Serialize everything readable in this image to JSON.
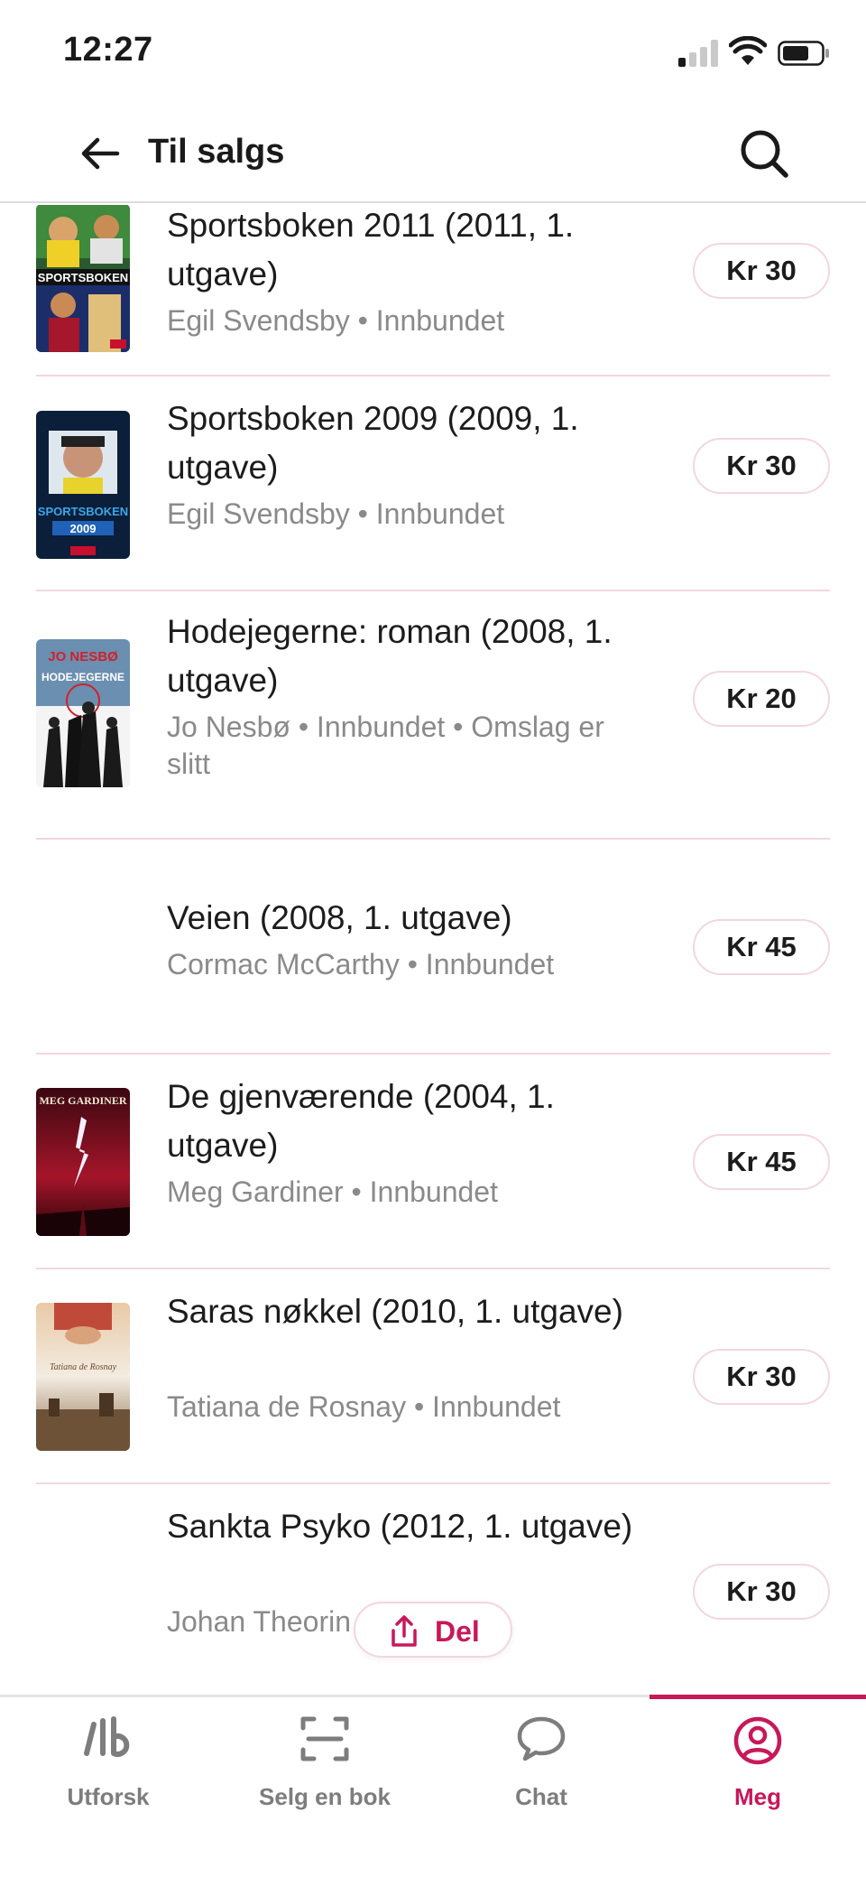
{
  "status_bar": {
    "time": "12:27"
  },
  "header": {
    "title": "Til salgs",
    "back_icon": "arrow-left-icon",
    "search_icon": "search-icon"
  },
  "items": [
    {
      "title": "Sportsboken 2011 (2011, 1. utgave)",
      "meta": "Egil Svendsby • Innbundet",
      "price": "Kr 30",
      "cover": "sportsboken-2011"
    },
    {
      "title": "Sportsboken 2009 (2009, 1. utgave)",
      "meta": "Egil Svendsby • Innbundet",
      "price": "Kr 30",
      "cover": "sportsboken-2009"
    },
    {
      "title": "Hodejegerne: roman (2008, 1. utgave)",
      "meta": "Jo Nesbø • Innbundet • Omslag er slitt",
      "price": "Kr 20",
      "cover": "hodejegerne"
    },
    {
      "title": "Veien (2008, 1. utgave)",
      "meta": "Cormac McCarthy • Innbundet",
      "price": "Kr 45",
      "cover": ""
    },
    {
      "title": "De gjenværende (2004, 1. utgave)",
      "meta": "Meg Gardiner • Innbundet",
      "price": "Kr 45",
      "cover": "de-gjenvaerende"
    },
    {
      "title": "Saras nøkkel (2010, 1. utgave)",
      "meta": "Tatiana de Rosnay • Innbundet",
      "price": "Kr 30",
      "cover": "saras-nokkel"
    },
    {
      "title": "Sankta Psyko (2012, 1. utgave)",
      "meta": "Johan Theorin • Pocket",
      "price": "Kr 30",
      "cover": ""
    }
  ],
  "cover_text": {
    "sportsboken_2011": "SPORTSBOKEN",
    "sportsboken_2009_title": "SPORTSBOKEN",
    "sportsboken_2009_year": "2009",
    "hodejegerne_author": "JO NESBØ",
    "hodejegerne_title": "HODEJEGERNE",
    "meg_gardiner": "MEG GARDINER",
    "tatiana": "Tatiana de Rosnay"
  },
  "share": {
    "label": "Del",
    "icon": "share-icon"
  },
  "tabs": [
    {
      "label": "Utforsk",
      "icon": "lb-logo-icon",
      "active": false
    },
    {
      "label": "Selg en bok",
      "icon": "scan-icon",
      "active": false
    },
    {
      "label": "Chat",
      "icon": "chat-bubble-icon",
      "active": false
    },
    {
      "label": "Meg",
      "icon": "profile-icon",
      "active": true
    }
  ],
  "colors": {
    "accent": "#c8185a",
    "divider": "#f3d6df",
    "muted": "#8a8a8a"
  }
}
